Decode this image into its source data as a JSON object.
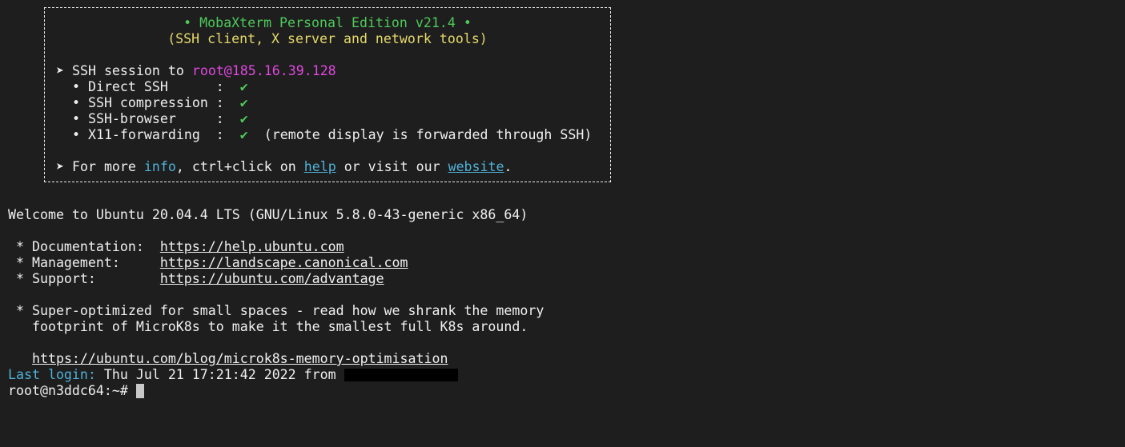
{
  "banner": {
    "title": "• MobaXterm Personal Edition v21.4 •",
    "subtitle": "(SSH client, X server and network tools)",
    "session_prefix": "➤ SSH session to ",
    "session_target": "root@185.16.39.128",
    "features": [
      {
        "label": "  • Direct SSH      :  ",
        "check": "✔",
        "note": ""
      },
      {
        "label": "  • SSH compression :  ",
        "check": "✔",
        "note": ""
      },
      {
        "label": "  • SSH-browser     :  ",
        "check": "✔",
        "note": ""
      },
      {
        "label": "  • X11-forwarding  :  ",
        "check": "✔",
        "note": "  (remote display is forwarded through SSH)"
      }
    ],
    "more_prefix": "➤ For more ",
    "more_info": "info",
    "more_mid": ", ctrl+click on ",
    "more_help": "help",
    "more_mid2": " or visit our ",
    "more_website": "website",
    "more_end": "."
  },
  "motd": {
    "welcome": "Welcome to Ubuntu 20.04.4 LTS (GNU/Linux 5.8.0-43-generic x86_64)",
    "doc_label": " * Documentation:  ",
    "doc_url": "https://help.ubuntu.com",
    "mgmt_label": " * Management:     ",
    "mgmt_url": "https://landscape.canonical.com",
    "support_label": " * Support:        ",
    "support_url": "https://ubuntu.com/advantage",
    "promo_line1": " * Super-optimized for small spaces - read how we shrank the memory",
    "promo_line2": "   footprint of MicroK8s to make it the smallest full K8s around.",
    "promo_url_indent": "   ",
    "promo_url": "https://ubuntu.com/blog/microk8s-memory-optimisation"
  },
  "login": {
    "label": "Last login:",
    "details": " Thu Jul 21 17:21:42 2022 from ",
    "prompt": "root@n3ddc64:~# "
  },
  "colors": {
    "background": "#1e1e1e",
    "foreground": "#f0f0f0",
    "green": "#4ec95a",
    "yellow": "#e6d86b",
    "magenta": "#e048e0",
    "cyan": "#4fb3d9"
  }
}
